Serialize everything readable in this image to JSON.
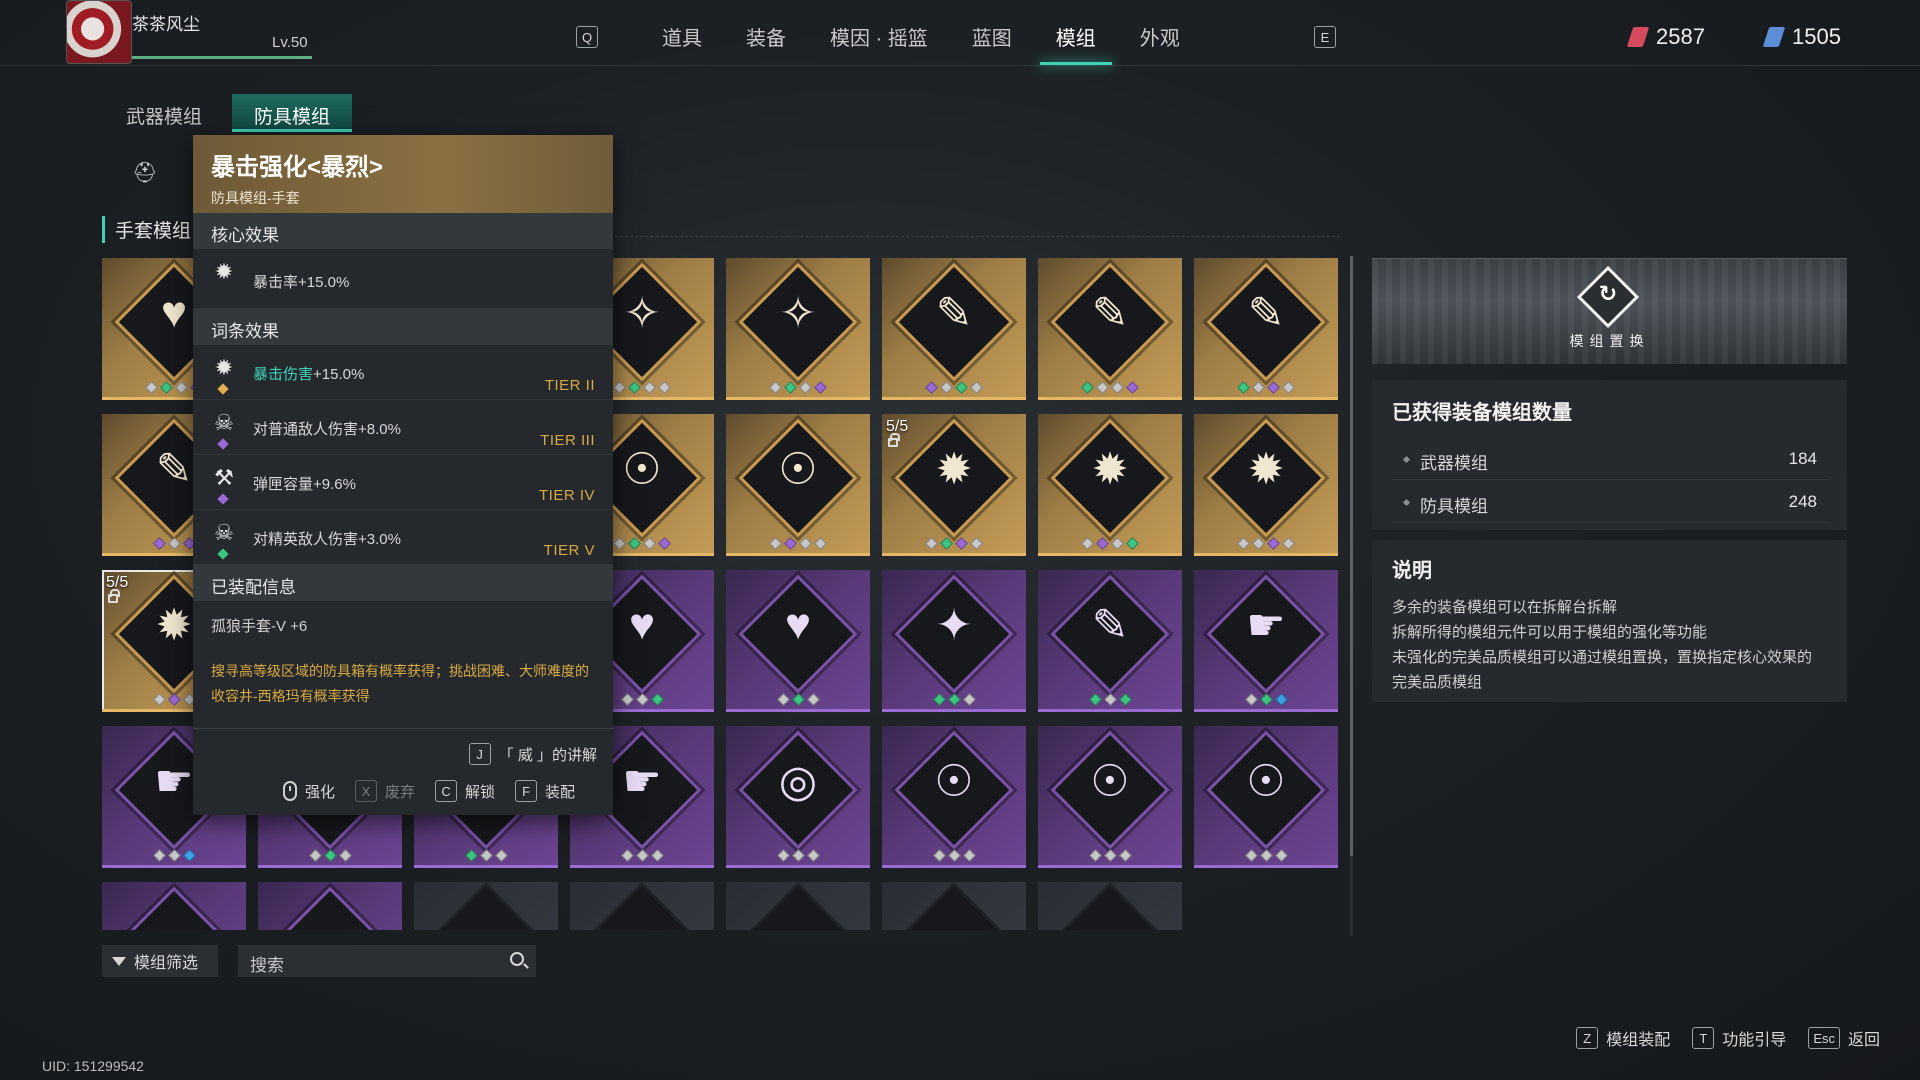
{
  "player": {
    "name": "茶茶风尘",
    "level": "Lv.50",
    "xp_fraction": 1.0
  },
  "nav": {
    "key_left": "Q",
    "key_right": "E",
    "tabs": [
      {
        "label": "道具"
      },
      {
        "label": "装备"
      },
      {
        "label": "模因 · 摇篮"
      },
      {
        "label": "蓝图"
      },
      {
        "label": "模组",
        "active": true
      },
      {
        "label": "外观"
      }
    ]
  },
  "currency": [
    {
      "value": "2587",
      "color": "#d64a5d"
    },
    {
      "value": "1505",
      "color": "#5b8ed6"
    }
  ],
  "subtabs": {
    "weapon": "武器模组",
    "armor": "防具模组",
    "active": "armor"
  },
  "section_title": "手套模组",
  "grid": {
    "cards": [
      {
        "rarity": "gold",
        "icon": "♥",
        "icon_name": "heart-pulse-icon",
        "gems": [
          "w",
          "g",
          "w",
          "p"
        ]
      },
      {
        "rarity": "gold",
        "icon": "✦",
        "icon_name": "crit-star-icon",
        "gems": [
          "g",
          "w",
          "p"
        ]
      },
      {
        "rarity": "gold",
        "icon": "✦",
        "icon_name": "crit-star-icon",
        "gems": [
          "w",
          "g",
          "w"
        ]
      },
      {
        "rarity": "gold",
        "icon": "✧",
        "icon_name": "spiked-star-icon",
        "gems": [
          "w",
          "g",
          "w",
          "w"
        ]
      },
      {
        "rarity": "gold",
        "icon": "✧",
        "icon_name": "spiked-star-icon",
        "gems": [
          "w",
          "g",
          "w",
          "p"
        ]
      },
      {
        "rarity": "gold",
        "icon": "✎",
        "icon_name": "blade-star-icon",
        "gems": [
          "p",
          "w",
          "g",
          "w"
        ]
      },
      {
        "rarity": "gold",
        "icon": "✎",
        "icon_name": "blade-star-icon",
        "gems": [
          "g",
          "w",
          "w",
          "p"
        ]
      },
      {
        "rarity": "gold",
        "icon": "✎",
        "icon_name": "blade-star-icon",
        "gems": [
          "g",
          "w",
          "p",
          "w"
        ]
      },
      {
        "rarity": "gold",
        "icon": "✎",
        "icon_name": "blade-star-icon",
        "gems": [
          "p",
          "w",
          "p"
        ]
      },
      {
        "rarity": "gold",
        "icon": "✦",
        "icon_name": "crit-star-icon",
        "gems": [
          "w",
          "w",
          "p"
        ]
      },
      {
        "rarity": "gold",
        "icon": "✦",
        "icon_name": "crit-star-icon",
        "gems": [
          "w",
          "w",
          "p"
        ]
      },
      {
        "rarity": "gold",
        "icon": "☉",
        "icon_name": "target-person-icon",
        "gems": [
          "w",
          "g",
          "w",
          "p"
        ]
      },
      {
        "rarity": "gold",
        "icon": "☉",
        "icon_name": "target-person-icon",
        "gems": [
          "w",
          "p",
          "w",
          "w"
        ]
      },
      {
        "rarity": "gold",
        "icon": "✹",
        "icon_name": "explosion-icon",
        "gems": [
          "w",
          "g",
          "p",
          "w"
        ],
        "count": "5/5",
        "locked": true
      },
      {
        "rarity": "gold",
        "icon": "✹",
        "icon_name": "explosion-icon",
        "gems": [
          "w",
          "p",
          "w",
          "g"
        ]
      },
      {
        "rarity": "gold",
        "icon": "✹",
        "icon_name": "explosion-icon",
        "gems": [
          "w",
          "w",
          "p",
          "w"
        ]
      },
      {
        "rarity": "gold",
        "icon": "✹",
        "icon_name": "crit-up-icon",
        "gems": [
          "w",
          "p",
          "w"
        ],
        "count": "5/5",
        "locked": true,
        "selected": true
      },
      {
        "rarity": "purple",
        "icon": "♥",
        "icon_name": "heart-pulse-icon",
        "gems": [
          "g",
          "w"
        ]
      },
      {
        "rarity": "purple",
        "icon": "♥",
        "icon_name": "heart-pulse-icon",
        "gems": [
          "w",
          "g"
        ]
      },
      {
        "rarity": "purple",
        "icon": "♥",
        "icon_name": "heart-pulse-icon",
        "gems": [
          "w",
          "w",
          "g"
        ]
      },
      {
        "rarity": "purple",
        "icon": "♥",
        "icon_name": "heart-pulse-icon",
        "gems": [
          "w",
          "g",
          "w"
        ]
      },
      {
        "rarity": "purple",
        "icon": "✦",
        "icon_name": "crit-star-icon",
        "gems": [
          "g",
          "g",
          "w"
        ]
      },
      {
        "rarity": "purple",
        "icon": "✎",
        "icon_name": "blade-star-icon",
        "gems": [
          "g",
          "w",
          "g"
        ]
      },
      {
        "rarity": "purple",
        "icon": "☛",
        "icon_name": "pistol-star-icon",
        "gems": [
          "w",
          "g",
          "b"
        ]
      },
      {
        "rarity": "purple",
        "icon": "☛",
        "icon_name": "pistol-star-icon",
        "gems": [
          "w",
          "w",
          "b"
        ]
      },
      {
        "rarity": "purple",
        "icon": "☛",
        "icon_name": "pistol-star-icon",
        "gems": [
          "w",
          "g",
          "w"
        ]
      },
      {
        "rarity": "purple",
        "icon": "☛",
        "icon_name": "pistol-star-icon",
        "gems": [
          "g",
          "w",
          "w"
        ]
      },
      {
        "rarity": "purple",
        "icon": "☛",
        "icon_name": "pistol-star-icon",
        "gems": [
          "w",
          "w",
          "w"
        ]
      },
      {
        "rarity": "purple",
        "icon": "◎",
        "icon_name": "vortex-icon",
        "gems": [
          "w",
          "w",
          "w"
        ]
      },
      {
        "rarity": "purple",
        "icon": "☉",
        "icon_name": "target-person-icon",
        "gems": [
          "w",
          "w",
          "w"
        ]
      },
      {
        "rarity": "purple",
        "icon": "☉",
        "icon_name": "target-person-icon",
        "gems": [
          "w",
          "w",
          "w"
        ]
      },
      {
        "rarity": "purple",
        "icon": "☉",
        "icon_name": "target-person-icon",
        "gems": [
          "w",
          "w",
          "w"
        ]
      },
      {
        "rarity": "purple",
        "icon": "",
        "icon_name": "partial-card-icon",
        "gems": []
      },
      {
        "rarity": "purple",
        "icon": "",
        "icon_name": "partial-card-icon",
        "gems": []
      },
      {
        "rarity": "dark",
        "icon": "",
        "icon_name": "partial-card-icon",
        "gems": []
      },
      {
        "rarity": "dark",
        "icon": "",
        "icon_name": "partial-card-icon",
        "gems": []
      },
      {
        "rarity": "dark",
        "icon": "",
        "icon_name": "partial-card-icon",
        "gems": []
      },
      {
        "rarity": "dark",
        "icon": "",
        "icon_name": "partial-card-icon",
        "gems": []
      },
      {
        "rarity": "dark",
        "icon": "",
        "icon_name": "partial-card-icon",
        "gems": []
      }
    ]
  },
  "tooltip": {
    "title": "暴击强化<暴烈>",
    "subtitle": "防具模组-手套",
    "core_header": "核心效果",
    "core_effect": "暴击率+15.0%",
    "affix_header": "词条效果",
    "affixes": [
      {
        "name": "暴击伤害",
        "value": "+15.0%",
        "tier": "TIER II",
        "gem": "y",
        "highlight": true
      },
      {
        "name": "对普通敌人伤害",
        "value": "+8.0%",
        "tier": "TIER III",
        "gem": "p"
      },
      {
        "name": "弹匣容量",
        "value": "+9.6%",
        "tier": "TIER IV",
        "gem": "p"
      },
      {
        "name": "对精英敌人伤害",
        "value": "+3.0%",
        "tier": "TIER V",
        "gem": "g"
      }
    ],
    "equip_header": "已装配信息",
    "equip_value": "孤狼手套-V +6",
    "source_text": "搜寻高等级区域的防具箱有概率获得；挑战困难、大师难度的收容井-西格玛有概率获得",
    "explain_key": "J",
    "explain_label": "「 威 」的讲解",
    "actions": [
      {
        "key": "",
        "label": "强化",
        "type": "mouse"
      },
      {
        "key": "X",
        "label": "废弃",
        "disabled": true
      },
      {
        "key": "C",
        "label": "解锁"
      },
      {
        "key": "F",
        "label": "装配"
      }
    ]
  },
  "scroll": {
    "position_fraction": 0.0
  },
  "filter": {
    "label": "模组筛选"
  },
  "search": {
    "placeholder": "搜索"
  },
  "right_panel": {
    "swap_label": "模组置换",
    "stats_title": "已获得装备模组数量",
    "stats": [
      {
        "label": "武器模组",
        "value": "184"
      },
      {
        "label": "防具模组",
        "value": "248"
      }
    ],
    "desc_title": "说明",
    "desc_lines": [
      "多余的装备模组可以在拆解台拆解",
      "拆解所得的模组元件可以用于模组的强化等功能",
      "未强化的完美品质模组可以通过模组置换，置换指定核心效果的",
      "完美品质模组"
    ]
  },
  "uid": "UID: 151299542",
  "hints": [
    {
      "key": "Z",
      "label": "模组装配"
    },
    {
      "key": "T",
      "label": "功能引导"
    },
    {
      "key": "Esc",
      "label": "返回"
    }
  ]
}
